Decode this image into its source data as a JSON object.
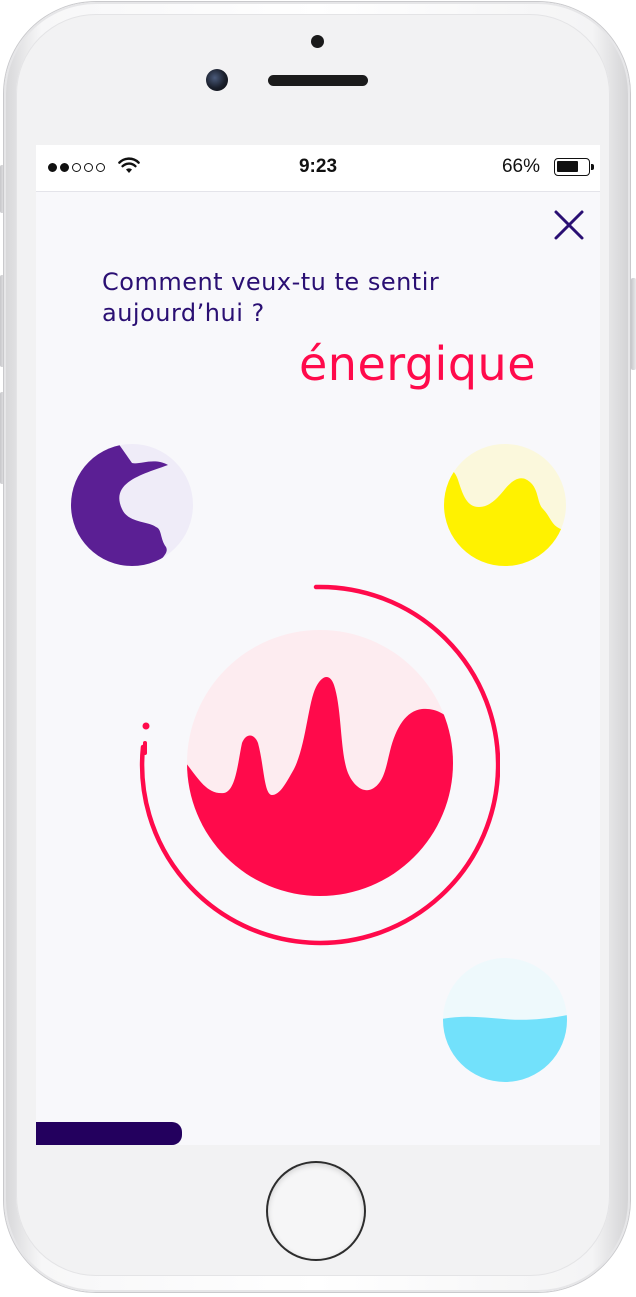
{
  "status_bar": {
    "time": "9:23",
    "battery_percent": "66%",
    "signal_bars_filled": 2,
    "signal_bars_total": 5,
    "battery_level": 0.66
  },
  "screen": {
    "question": "Comment veux-tu te sentir aujourd’hui ?",
    "selected_mood": "énergique",
    "close_icon": "close-icon"
  },
  "moods": [
    {
      "id": "purple",
      "color": "#5b1f94",
      "light": "#efecf8"
    },
    {
      "id": "yellow",
      "color": "#fff200",
      "light": "#fbf8dc"
    },
    {
      "id": "energique",
      "color": "#ff0a4b",
      "light": "#fdecf0",
      "selected": true
    },
    {
      "id": "blue",
      "color": "#72e1fb",
      "light": "#eef9fc"
    }
  ],
  "colors": {
    "accent": "#ff0a4b",
    "text_primary": "#2a0f73",
    "progress": "#23005e",
    "screen_bg": "#f8f8fb"
  },
  "progress": {
    "fraction": 0.26
  }
}
